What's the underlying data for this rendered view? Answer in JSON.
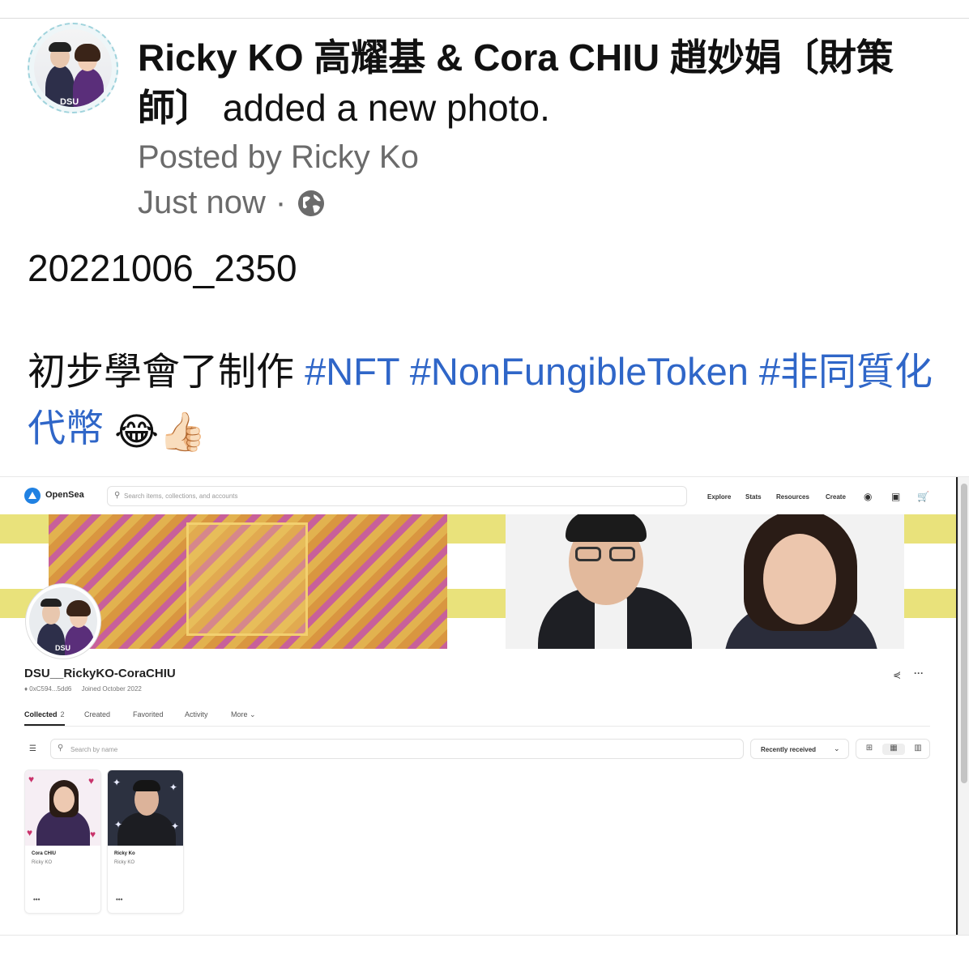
{
  "post": {
    "author_names": "Ricky KO 高耀基 & Cora CHIU 趙妙娟〔財策師〕",
    "action": "added a new photo.",
    "posted_by": "Posted by Ricky Ko",
    "time": "Just now",
    "separator": "·",
    "avatar_tag": "DSU",
    "code": "20221006_2350",
    "text_lead": "初步學會了制作 ",
    "hashtags": [
      "#NFT",
      "#NonFungibleToken",
      "#非同質化代幣"
    ],
    "emojis": [
      "😂",
      "👍🏻"
    ],
    "globe_icon": "globe-icon"
  },
  "screenshot": {
    "brand": "OpenSea",
    "search_placeholder": "Search items, collections, and accounts",
    "nav": [
      "Explore",
      "Stats",
      "Resources",
      "Create"
    ],
    "icons": [
      "profile-icon",
      "wallet-icon",
      "cart-icon"
    ],
    "avatar_tag": "DSU",
    "profile_name": "DSU__RickyKO-CoraCHIU",
    "address": "♦ 0xC594...5dd6",
    "joined": "Joined October 2022",
    "tabs": [
      {
        "label": "Collected",
        "count": "2"
      },
      {
        "label": "Created"
      },
      {
        "label": "Favorited"
      },
      {
        "label": "Activity"
      },
      {
        "label": "More ⌄"
      }
    ],
    "items_search_placeholder": "Search by name",
    "sort_label": "Recently received",
    "cards": [
      {
        "name": "Cora CHIU",
        "collection": "Ricky KO",
        "more": "•••"
      },
      {
        "name": "Ricky Ko",
        "collection": "Ricky KO",
        "more": "•••"
      }
    ],
    "colors": {
      "accent": "#2081e2",
      "banner_stripe": "#e9e27b",
      "hashtag": "#2f66c8"
    }
  }
}
